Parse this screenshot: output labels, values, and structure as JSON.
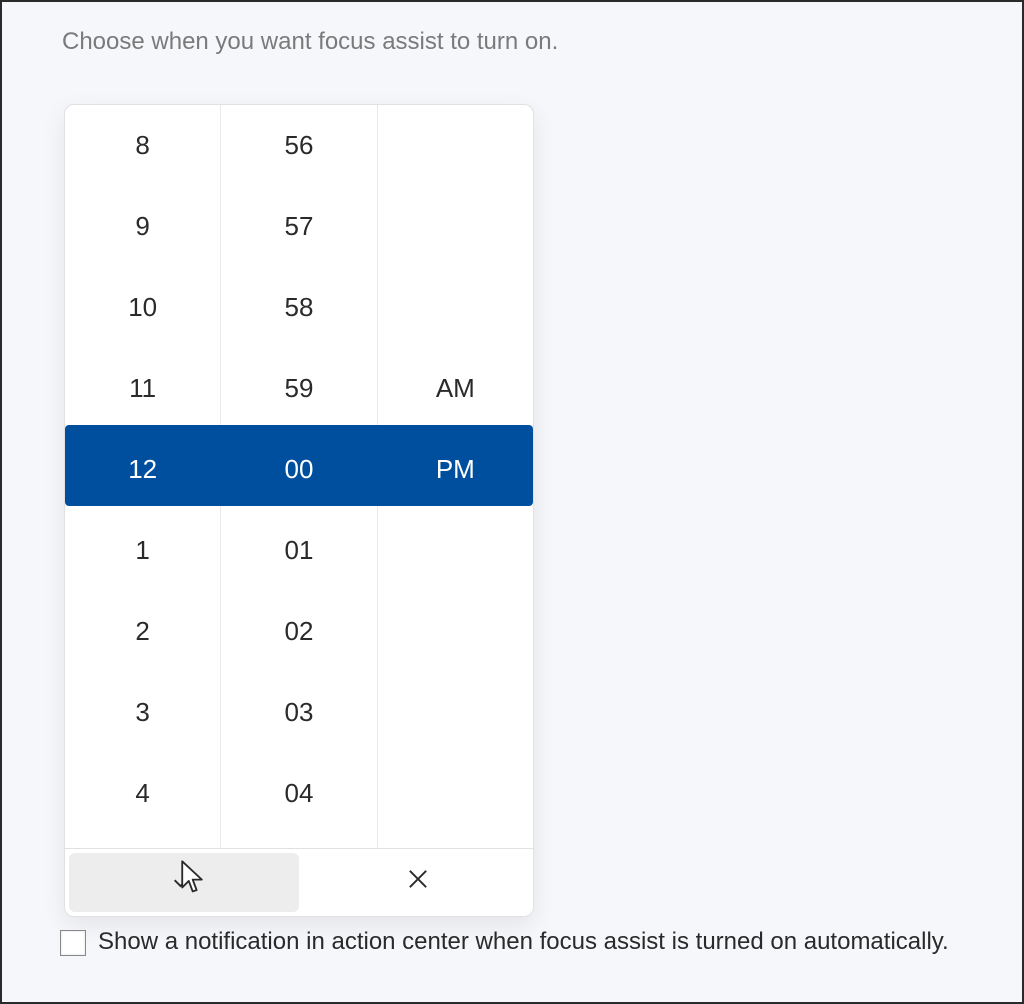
{
  "title": "Choose when you want focus assist to turn on.",
  "picker": {
    "hours": [
      "8",
      "9",
      "10",
      "11",
      "12",
      "1",
      "2",
      "3",
      "4"
    ],
    "minutes": [
      "56",
      "57",
      "58",
      "59",
      "00",
      "01",
      "02",
      "03",
      "04"
    ],
    "ampm": [
      "",
      "",
      "",
      "AM",
      "PM",
      "",
      "",
      "",
      ""
    ],
    "selected_index": 4
  },
  "footer": {
    "accept_icon": "checkmark-icon",
    "cancel_icon": "close-icon"
  },
  "checkbox": {
    "checked": false,
    "label": "Show a notification in action center when focus assist is turned on automatically."
  }
}
